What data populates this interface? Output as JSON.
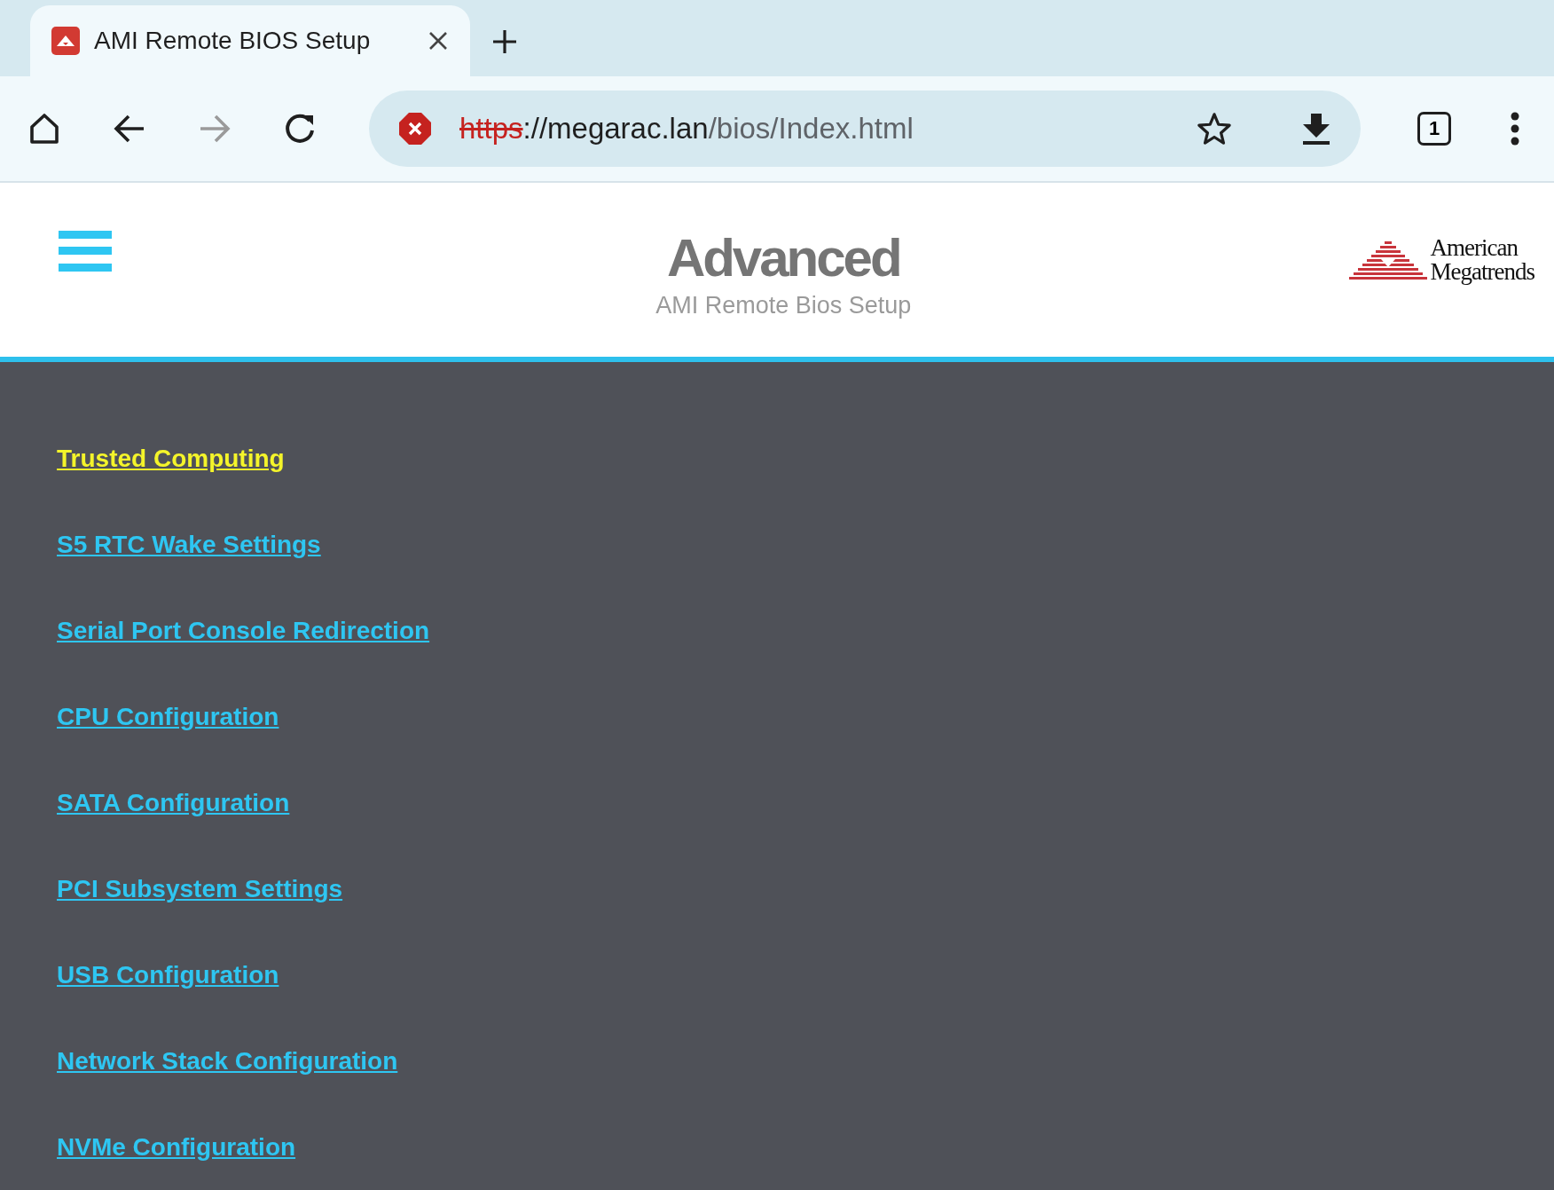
{
  "browser": {
    "tab": {
      "title": "AMI Remote BIOS Setup",
      "selected": true
    },
    "url": {
      "scheme": "https",
      "rest_host": "://megarac.lan",
      "rest_path": "/bios/Index.html",
      "insecure": true
    },
    "tab_count": "1"
  },
  "header": {
    "title": "Advanced",
    "subtitle": "AMI Remote Bios Setup",
    "logo_lines": [
      "American",
      "Megatrends"
    ]
  },
  "menu": [
    {
      "label": "Trusted Computing",
      "selected": true
    },
    {
      "label": "S5 RTC Wake Settings",
      "selected": false
    },
    {
      "label": "Serial Port Console Redirection",
      "selected": false
    },
    {
      "label": "CPU Configuration",
      "selected": false
    },
    {
      "label": "SATA Configuration",
      "selected": false
    },
    {
      "label": "PCI Subsystem Settings",
      "selected": false
    },
    {
      "label": "USB Configuration",
      "selected": false
    },
    {
      "label": "Network Stack Configuration",
      "selected": false
    },
    {
      "label": "NVMe Configuration",
      "selected": false
    }
  ]
}
